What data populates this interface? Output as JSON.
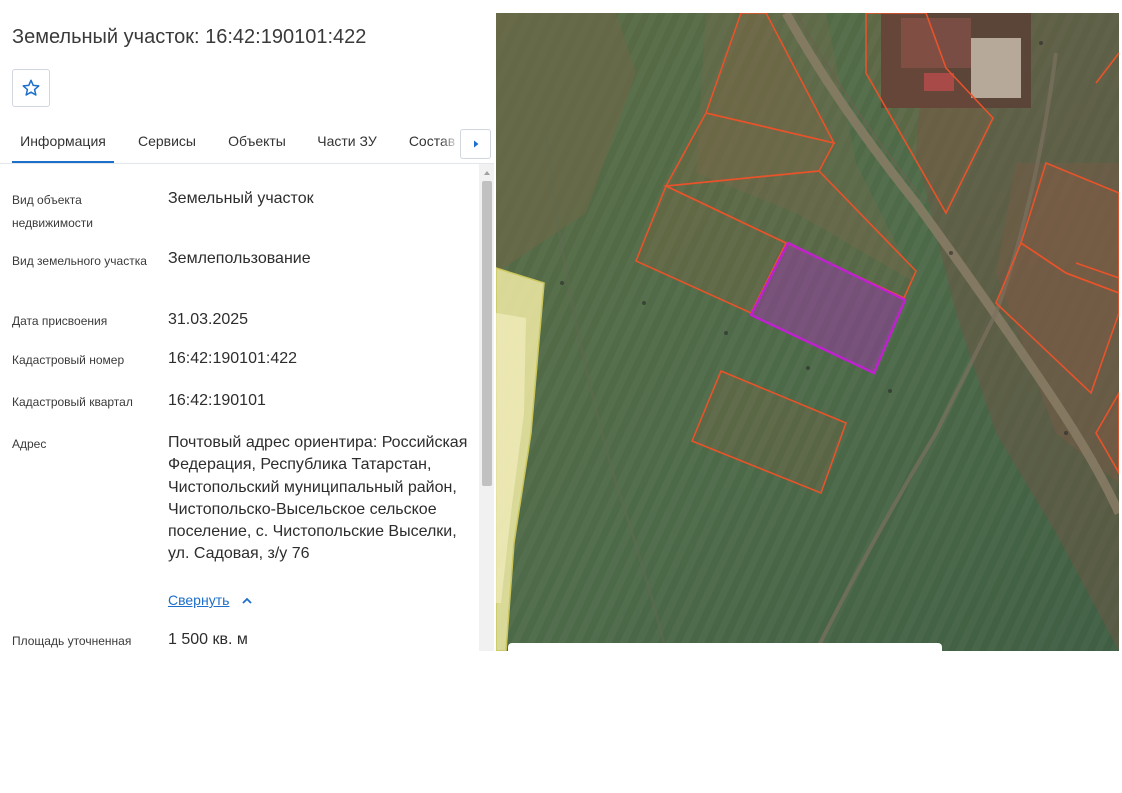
{
  "page": {
    "title": "Земельный участок: 16:42:190101:422"
  },
  "toolbar": {
    "favorite_icon": "star-outline-icon"
  },
  "tabs": [
    {
      "label": "Информация",
      "active": true
    },
    {
      "label": "Сервисы",
      "active": false
    },
    {
      "label": "Объекты",
      "active": false
    },
    {
      "label": "Части ЗУ",
      "active": false
    },
    {
      "label": "Состав",
      "active": false
    }
  ],
  "tabs_scroll_icon": "caret-right-icon",
  "info": {
    "rows": [
      {
        "label": "Вид объекта недвижимости",
        "value": "Земельный участок"
      },
      {
        "label": "Вид земельного участка",
        "value": "Землепользование"
      },
      {
        "label": "Дата присвоения",
        "value": "31.03.2025"
      },
      {
        "label": "Кадастровый номер",
        "value": "16:42:190101:422"
      },
      {
        "label": "Кадастровый квартал",
        "value": "16:42:190101"
      },
      {
        "label": "Адрес",
        "value": "Почтовый адрес ориентира: Российская Федерация, Республика Татарстан, Чистопольский муниципальный район, Чистопольско-Высельское сельское поселение, с. Чистопольские Выселки, ул. Садовая, з/у 76"
      },
      {
        "label": "Площадь уточненная",
        "value": "1 500 кв. м"
      }
    ],
    "collapse_label": "Свернуть"
  },
  "colors": {
    "accent": "#1d6fc9",
    "parcel_outline": "#e8532a",
    "selected_parcel": "#c020d0",
    "quarter_boundary": "#f3eb7a"
  }
}
